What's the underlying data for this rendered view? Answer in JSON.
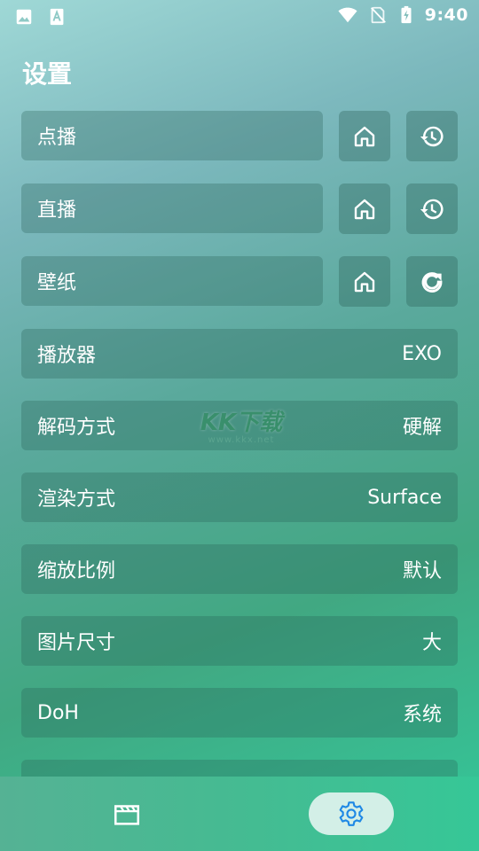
{
  "status_bar": {
    "time": "9:40",
    "icons": [
      "image-icon",
      "text-a-icon",
      "wifi-icon",
      "no-sim-icon",
      "battery-charging-icon"
    ]
  },
  "page": {
    "title": "设置"
  },
  "rows": [
    {
      "label": "点播",
      "value": "",
      "buttons": [
        "home-icon",
        "history-icon"
      ]
    },
    {
      "label": "直播",
      "value": "",
      "buttons": [
        "home-icon",
        "history-icon"
      ]
    },
    {
      "label": "壁纸",
      "value": "",
      "buttons": [
        "home-icon",
        "refresh-icon"
      ]
    },
    {
      "label": "播放器",
      "value": "EXO"
    },
    {
      "label": "解码方式",
      "value": "硬解"
    },
    {
      "label": "渲染方式",
      "value": "Surface"
    },
    {
      "label": "缩放比例",
      "value": "默认"
    },
    {
      "label": "图片尺寸",
      "value": "大"
    },
    {
      "label": "DoH",
      "value": "系统"
    }
  ],
  "watermark": {
    "main": "KK下载",
    "sub": "www.kkx.net"
  },
  "bottom_nav": {
    "items": [
      {
        "icon": "film-icon",
        "active": false
      },
      {
        "icon": "gear-icon",
        "active": true
      }
    ],
    "active_color": "#1e88e5",
    "active_bg": "#d3efe7"
  }
}
